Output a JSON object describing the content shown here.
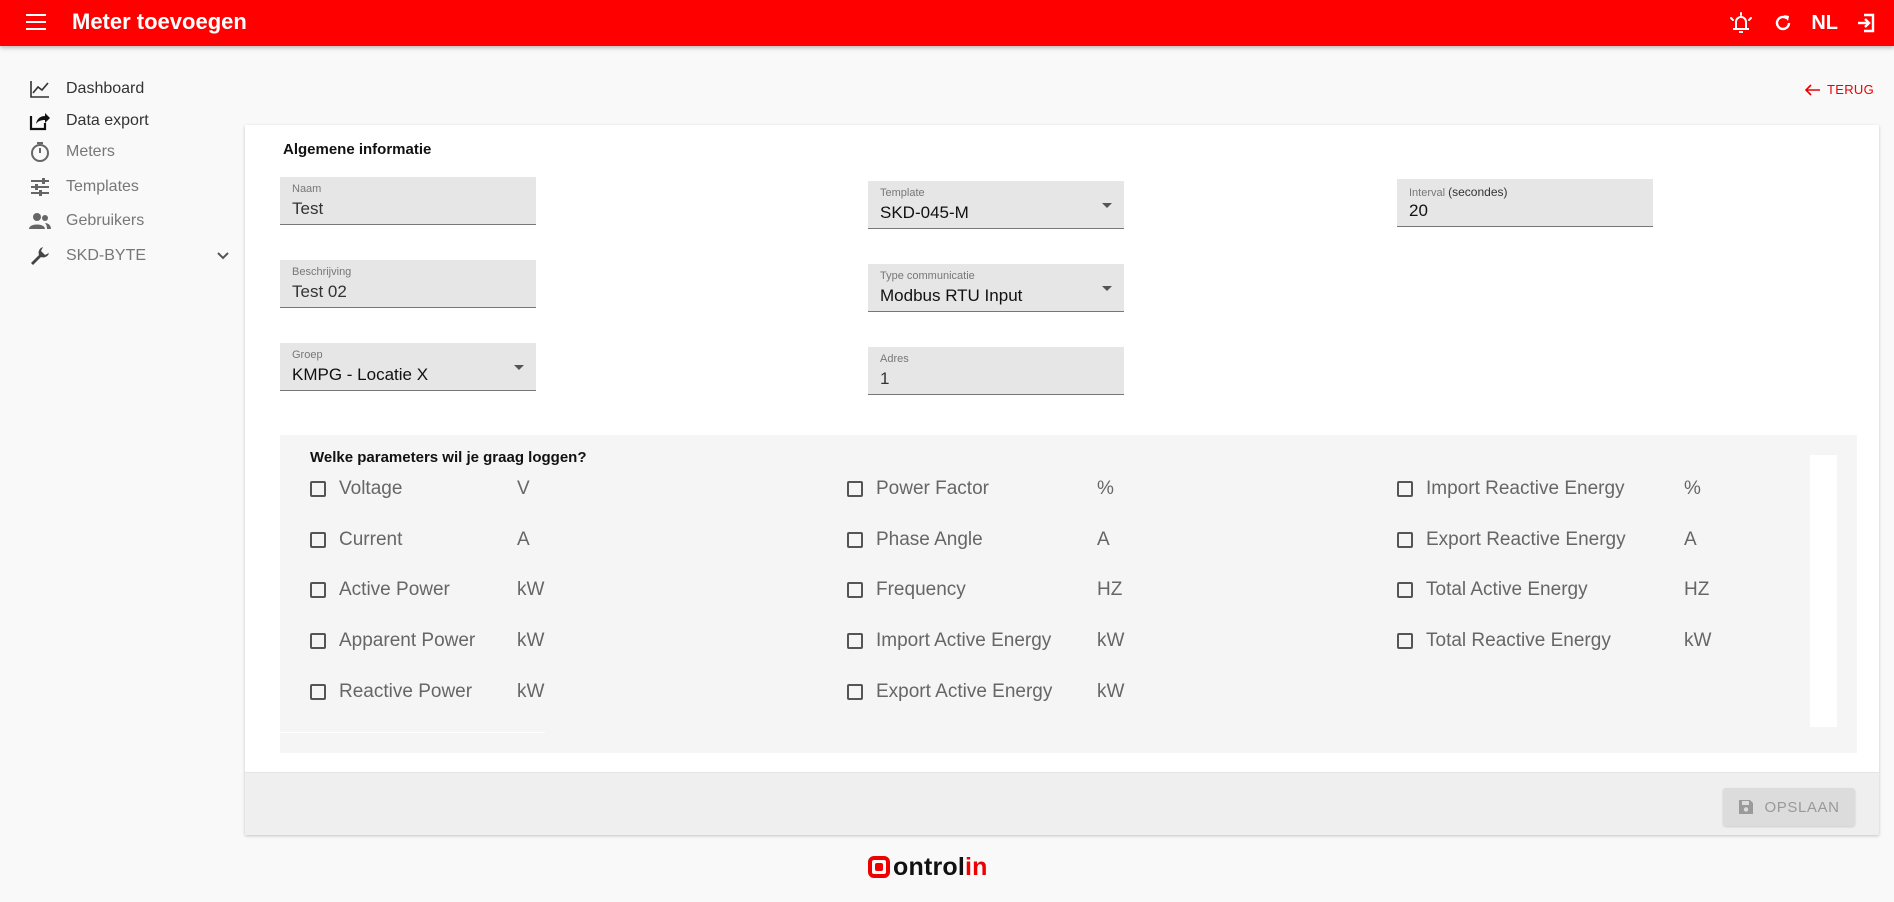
{
  "header": {
    "title": "Meter toevoegen",
    "language": "NL"
  },
  "sidebar": {
    "items": [
      {
        "label": "Dashboard",
        "icon": "chart-line-icon"
      },
      {
        "label": "Data export",
        "icon": "export-icon"
      },
      {
        "label": "Meters",
        "icon": "timer-icon"
      },
      {
        "label": "Templates",
        "icon": "tune-icon"
      },
      {
        "label": "Gebruikers",
        "icon": "users-icon"
      },
      {
        "label": "SKD-BYTE",
        "icon": "wrench-icon"
      }
    ]
  },
  "back": {
    "label": "TERUG"
  },
  "form": {
    "section_title": "Algemene informatie",
    "naam": {
      "label": "Naam",
      "value": "Test"
    },
    "beschrijving": {
      "label": "Beschrijving",
      "value": "Test 02"
    },
    "groep": {
      "label": "Groep",
      "value": "KMPG - Locatie X"
    },
    "template": {
      "label": "Template",
      "value": "SKD-045-M"
    },
    "type_communicatie": {
      "label": "Type communicatie",
      "value": "Modbus RTU Input"
    },
    "adres": {
      "label": "Adres",
      "value": "1"
    },
    "interval": {
      "label": "Interval",
      "label_suffix": "(secondes)",
      "value": "20"
    }
  },
  "parameters": {
    "title": "Welke parameters wil je graag loggen?",
    "items": [
      {
        "name": "Voltage",
        "unit": "V"
      },
      {
        "name": "Current",
        "unit": "A"
      },
      {
        "name": "Active Power",
        "unit": "kW"
      },
      {
        "name": "Apparent Power",
        "unit": "kW"
      },
      {
        "name": "Reactive Power",
        "unit": "kW"
      },
      {
        "name": "Power Factor",
        "unit": "%"
      },
      {
        "name": "Phase Angle",
        "unit": "A"
      },
      {
        "name": "Frequency",
        "unit": "HZ"
      },
      {
        "name": "Import Active Energy",
        "unit": "kW"
      },
      {
        "name": "Export Active Energy",
        "unit": "kW"
      },
      {
        "name": "Import Reactive Energy",
        "unit": "%"
      },
      {
        "name": "Export Reactive Energy",
        "unit": "A"
      },
      {
        "name": "Total Active Energy",
        "unit": "HZ"
      },
      {
        "name": "Total Reactive Energy",
        "unit": "kW"
      }
    ]
  },
  "footer": {
    "save_label": "OPSLAAN"
  },
  "logo": {
    "text_dark": "ontrol",
    "text_red": "in"
  },
  "colors": {
    "accent": "#ff0000"
  }
}
